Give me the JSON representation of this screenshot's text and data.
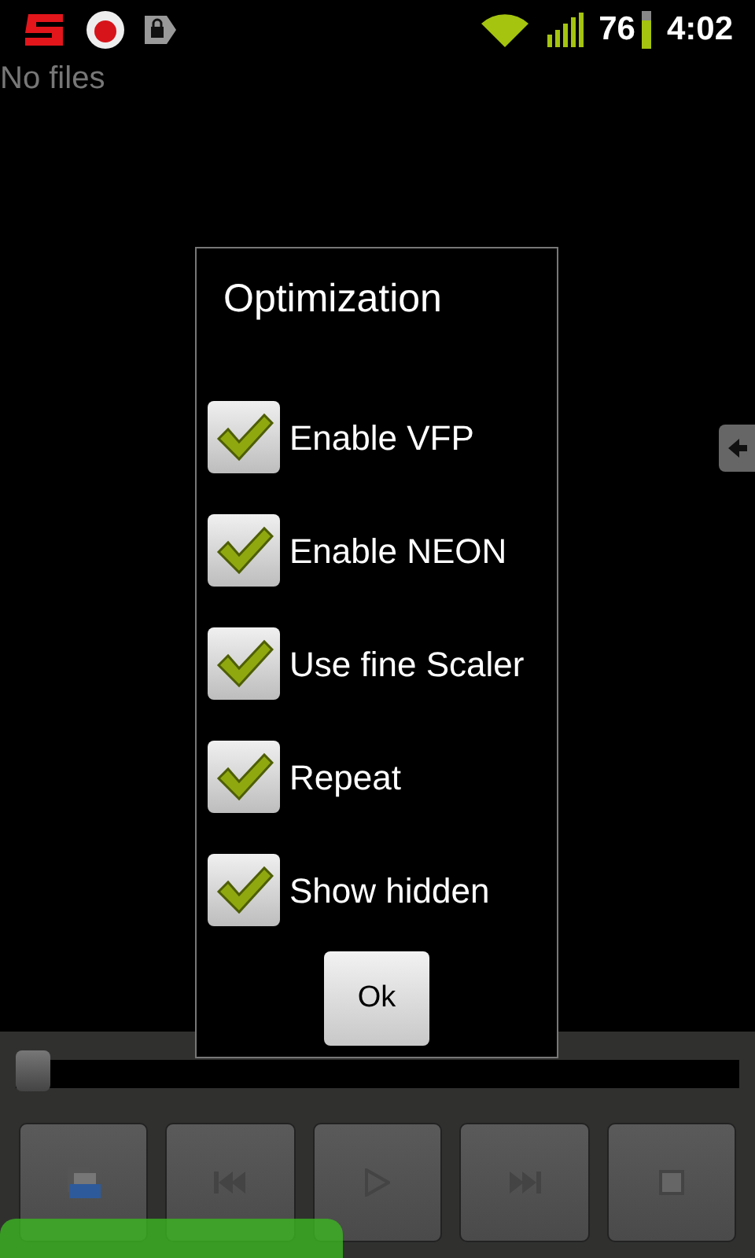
{
  "status_bar": {
    "battery": "76",
    "time": "4:02"
  },
  "file_list": {
    "empty_text": "No files"
  },
  "dialog": {
    "title": "Optimization",
    "options": [
      {
        "label": "Enable VFP",
        "checked": true
      },
      {
        "label": "Enable NEON",
        "checked": true
      },
      {
        "label": "Use fine Scaler",
        "checked": true
      },
      {
        "label": "Repeat",
        "checked": true
      },
      {
        "label": "Show hidden",
        "checked": true
      }
    ],
    "button": "Ok"
  },
  "seek_bar": {
    "level": 0
  },
  "controls": [
    {
      "kind": "open"
    },
    {
      "kind": "previous"
    },
    {
      "kind": "play"
    },
    {
      "kind": "next"
    },
    {
      "kind": "stop"
    }
  ]
}
